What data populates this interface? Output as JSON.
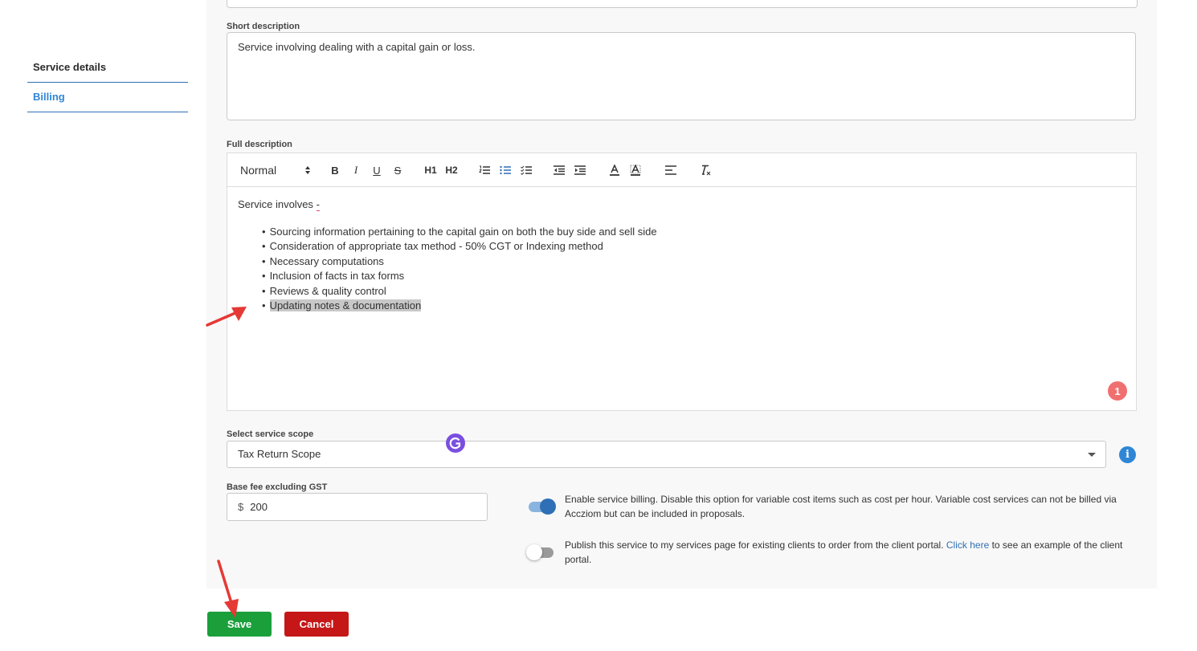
{
  "nav": {
    "items": [
      {
        "label": "Service details"
      },
      {
        "label": "Billing"
      }
    ]
  },
  "short_description": {
    "label": "Short description",
    "value": "Service involving dealing with a capital gain or loss."
  },
  "full_description": {
    "label": "Full description",
    "toolbar": {
      "format": "Normal",
      "buttons": [
        "B",
        "I",
        "U",
        "S",
        "H1",
        "H2"
      ]
    },
    "intro": "Service involves",
    "intro_suffix": "-",
    "bullets": [
      "Sourcing information pertaining to the capital gain on both the buy side and sell side",
      "Consideration of appropriate tax method - 50% CGT or Indexing method",
      "Necessary computations",
      "Inclusion of facts in tax forms",
      "Reviews & quality control",
      "Updating notes & documentation"
    ],
    "notification_count": "1"
  },
  "service_scope": {
    "label": "Select service scope",
    "value": "Tax Return Scope"
  },
  "base_fee": {
    "label": "Base fee excluding GST",
    "currency": "$",
    "value": "200"
  },
  "billing_toggle": {
    "enabled": true,
    "text": "Enable service billing. Disable this option for variable cost items such as cost per hour. Variable cost services can not be billed via Accziom but can be included in proposals."
  },
  "publish_toggle": {
    "enabled": false,
    "text_before": "Publish this service to my services page for existing clients to order from the client portal.",
    "link": "Click here",
    "text_after": "to see an example of the client portal."
  },
  "actions": {
    "save": "Save",
    "cancel": "Cancel"
  },
  "colors": {
    "accent": "#2f6fb5",
    "save": "#1a9f3b",
    "cancel": "#c51717"
  }
}
